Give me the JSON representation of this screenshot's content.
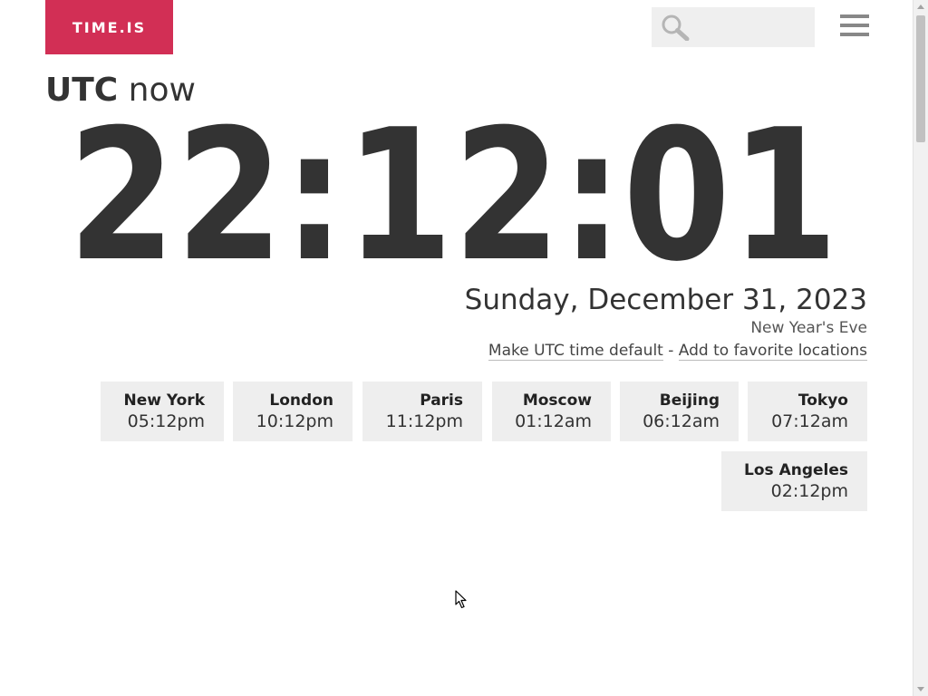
{
  "header": {
    "logo_text": "TIME.IS",
    "logo_color": "#d22f55",
    "search": {
      "placeholder": "",
      "icon": "search-icon"
    },
    "menu_icon": "hamburger-menu-icon"
  },
  "title": {
    "zone": "UTC",
    "suffix": "now"
  },
  "clock": {
    "time": "22:12:01"
  },
  "date": {
    "full": "Sunday, December 31, 2023",
    "holiday": "New Year's Eve"
  },
  "actions": {
    "make_default": "Make UTC time default",
    "separator": " - ",
    "add_favorite": "Add to favorite locations"
  },
  "cities": [
    {
      "name": "New York",
      "time": "05:12pm"
    },
    {
      "name": "London",
      "time": "10:12pm"
    },
    {
      "name": "Paris",
      "time": "11:12pm"
    },
    {
      "name": "Moscow",
      "time": "01:12am"
    },
    {
      "name": "Beijing",
      "time": "06:12am"
    },
    {
      "name": "Tokyo",
      "time": "07:12am"
    },
    {
      "name": "Los Angeles",
      "time": "02:12pm"
    }
  ]
}
